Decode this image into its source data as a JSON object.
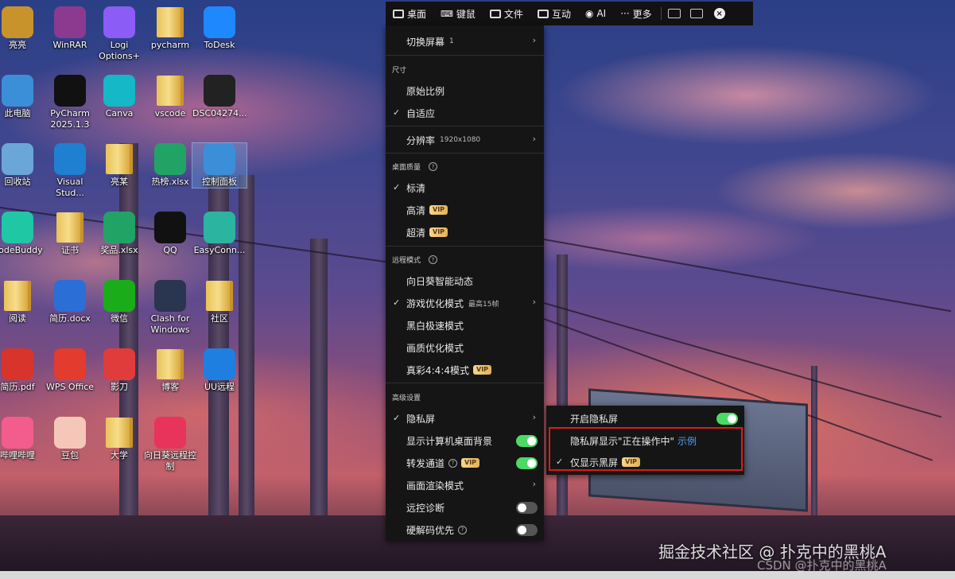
{
  "desktop": {
    "icons": [
      {
        "label": "亮亮",
        "color": "#c9932c",
        "kind": "user"
      },
      {
        "label": "WinRAR",
        "color": "#8b3a8f",
        "kind": "app"
      },
      {
        "label": "Logi Options+",
        "color": "#8b5cf6",
        "kind": "app"
      },
      {
        "label": "pycharm",
        "color": "#e8c25a",
        "kind": "folder"
      },
      {
        "label": "ToDesk",
        "color": "#1e88ff",
        "kind": "app"
      },
      {
        "label": "此电脑",
        "color": "#3b8fd9",
        "kind": "app"
      },
      {
        "label": "PyCharm 2025.1.3",
        "color": "#111111",
        "kind": "app"
      },
      {
        "label": "Canva",
        "color": "#14b8c6",
        "kind": "app"
      },
      {
        "label": "vscode",
        "color": "#e8c25a",
        "kind": "folder"
      },
      {
        "label": "DSC04274...",
        "color": "#222222",
        "kind": "app"
      },
      {
        "label": "回收站",
        "color": "#6aa7d8",
        "kind": "app"
      },
      {
        "label": "Visual Stud...",
        "color": "#1f7fd1",
        "kind": "app"
      },
      {
        "label": "亮某",
        "color": "#e8c25a",
        "kind": "folder"
      },
      {
        "label": "热榜.xlsx",
        "color": "#21a366",
        "kind": "app"
      },
      {
        "label": "控制面板",
        "color": "#3b8fd9",
        "kind": "app"
      },
      {
        "label": "CodeBuddy",
        "color": "#1fc7a5",
        "kind": "app"
      },
      {
        "label": "证书",
        "color": "#e8c25a",
        "kind": "folder"
      },
      {
        "label": "奖品.xlsx",
        "color": "#21a366",
        "kind": "app"
      },
      {
        "label": "QQ",
        "color": "#111111",
        "kind": "app"
      },
      {
        "label": "EasyConn...",
        "color": "#2bb5a0",
        "kind": "app"
      },
      {
        "label": "阅读",
        "color": "#e8c25a",
        "kind": "folder"
      },
      {
        "label": "简历.docx",
        "color": "#2b6fd6",
        "kind": "app"
      },
      {
        "label": "微信",
        "color": "#1aad19",
        "kind": "app"
      },
      {
        "label": "Clash for Windows",
        "color": "#2a3550",
        "kind": "app"
      },
      {
        "label": "社区",
        "color": "#e8c25a",
        "kind": "folder"
      },
      {
        "label": "简历.pdf",
        "color": "#d8342b",
        "kind": "app"
      },
      {
        "label": "WPS Office",
        "color": "#e33b2e",
        "kind": "app"
      },
      {
        "label": "影刀",
        "color": "#e03c3c",
        "kind": "app"
      },
      {
        "label": "博客",
        "color": "#e8c25a",
        "kind": "folder"
      },
      {
        "label": "UU远程",
        "color": "#1f7fe0",
        "kind": "app"
      },
      {
        "label": "哔哩哔哩",
        "color": "#f25d8e",
        "kind": "app"
      },
      {
        "label": "豆包",
        "color": "#f4c7b8",
        "kind": "app"
      },
      {
        "label": "大学",
        "color": "#e8c25a",
        "kind": "folder"
      },
      {
        "label": "向日葵远程控制",
        "color": "#e8345a",
        "kind": "app"
      }
    ]
  },
  "toolbar": {
    "items": [
      {
        "label": "桌面",
        "icon": "monitor-icon"
      },
      {
        "label": "键鼠",
        "icon": "keyboard-icon"
      },
      {
        "label": "文件",
        "icon": "folder-icon"
      },
      {
        "label": "互动",
        "icon": "chat-icon"
      },
      {
        "label": "AI",
        "icon": "eye-icon"
      },
      {
        "label": "更多",
        "icon": "more-dots-icon"
      }
    ],
    "close_glyph": "×"
  },
  "menu": {
    "switch_screen": "切换屏幕",
    "switch_screen_count": "1",
    "size_header": "尺寸",
    "original_ratio": "原始比例",
    "adaptive": "自适应",
    "resolution": "分辨率",
    "resolution_value": "1920x1080",
    "quality_header": "桌面质量",
    "standard": "标清",
    "high": "高清",
    "ultra": "超清",
    "vip": "VIP",
    "remote_mode_header": "远程模式",
    "smart_dynamic": "向日葵智能动态",
    "game_mode": "游戏优化模式",
    "game_mode_sub": "最高15帧",
    "bw_mode": "黑白极速模式",
    "quality_mode": "画质优化模式",
    "true_color": "真彩4:4:4模式",
    "advanced_header": "高级设置",
    "privacy_screen": "隐私屏",
    "show_desktop_bg": "显示计算机桌面背景",
    "relay_channel": "转发通道",
    "render_mode": "画面渲染模式",
    "diagnostics": "远控诊断",
    "hw_decode": "硬解码优先"
  },
  "submenu": {
    "enable_privacy": "开启隐私屏",
    "show_operating": "隐私屏显示\"正在操作中\"",
    "example_link": "示例",
    "black_only": "仅显示黑屏"
  },
  "watermark": {
    "main": "掘金技术社区 @ 扑克中的黑桃A",
    "sub": "CSDN @扑克中的黑桃A"
  }
}
